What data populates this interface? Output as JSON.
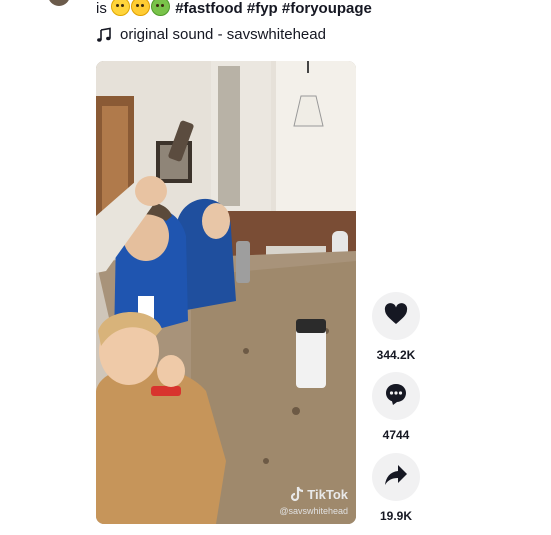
{
  "post": {
    "caption_prefix": "is",
    "emojis": [
      "flushed-face-emoji",
      "woozy-face-emoji",
      "nauseated-face-emoji"
    ],
    "hashtags": [
      "#fastfood",
      "#fyp",
      "#foryoupage"
    ],
    "music": "original sound - savswhitehead"
  },
  "video": {
    "watermark_brand": "TikTok",
    "watermark_user": "@savswhitehead"
  },
  "actions": {
    "like_count": "344.2K",
    "comment_count": "4744",
    "share_count": "19.9K"
  },
  "colors": {
    "text": "#161823",
    "action_bg": "#f1f1f2"
  }
}
